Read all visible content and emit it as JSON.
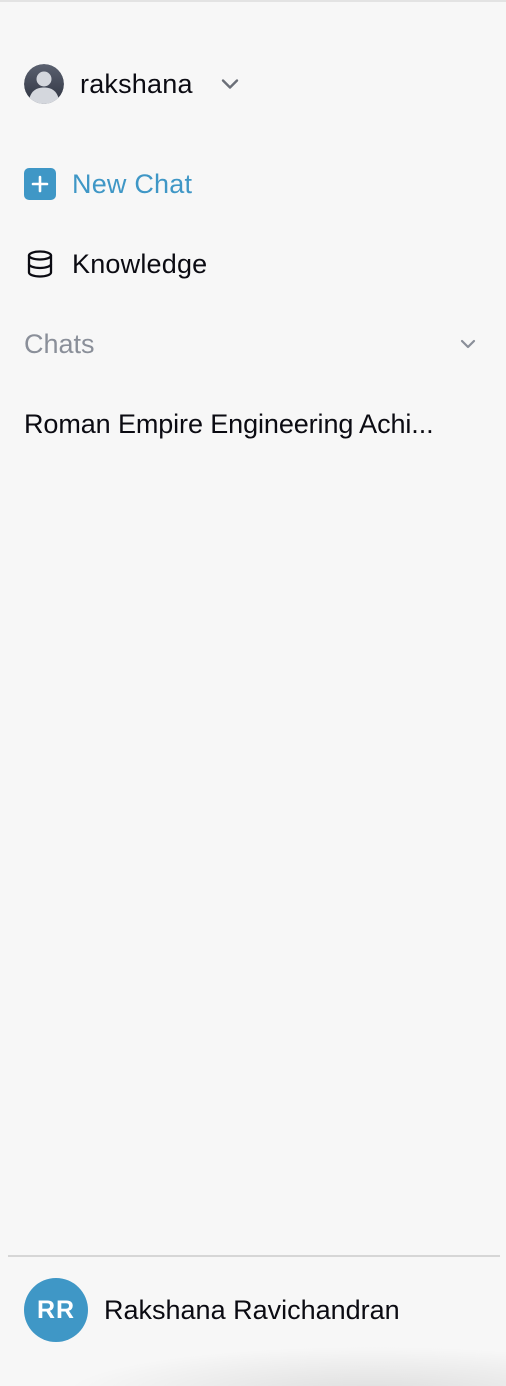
{
  "workspace": {
    "name": "rakshana",
    "avatar_icon": "default-user-avatar-icon",
    "toggle_icon": "chevron-down-icon"
  },
  "nav": {
    "new_chat_label": "New Chat",
    "new_chat_icon": "plus-icon",
    "knowledge_label": "Knowledge",
    "knowledge_icon": "database-icon"
  },
  "chats": {
    "header_label": "Chats",
    "collapse_icon": "chevron-down-icon",
    "items": [
      {
        "title": "Roman Empire Engineering Achi..."
      }
    ]
  },
  "user": {
    "initials": "RR",
    "full_name": "Rakshana Ravichandran"
  },
  "colors": {
    "accent": "#3f97c6",
    "background": "#f7f7f7",
    "muted_text": "#8a8f99",
    "divider": "#d6d6d6"
  }
}
